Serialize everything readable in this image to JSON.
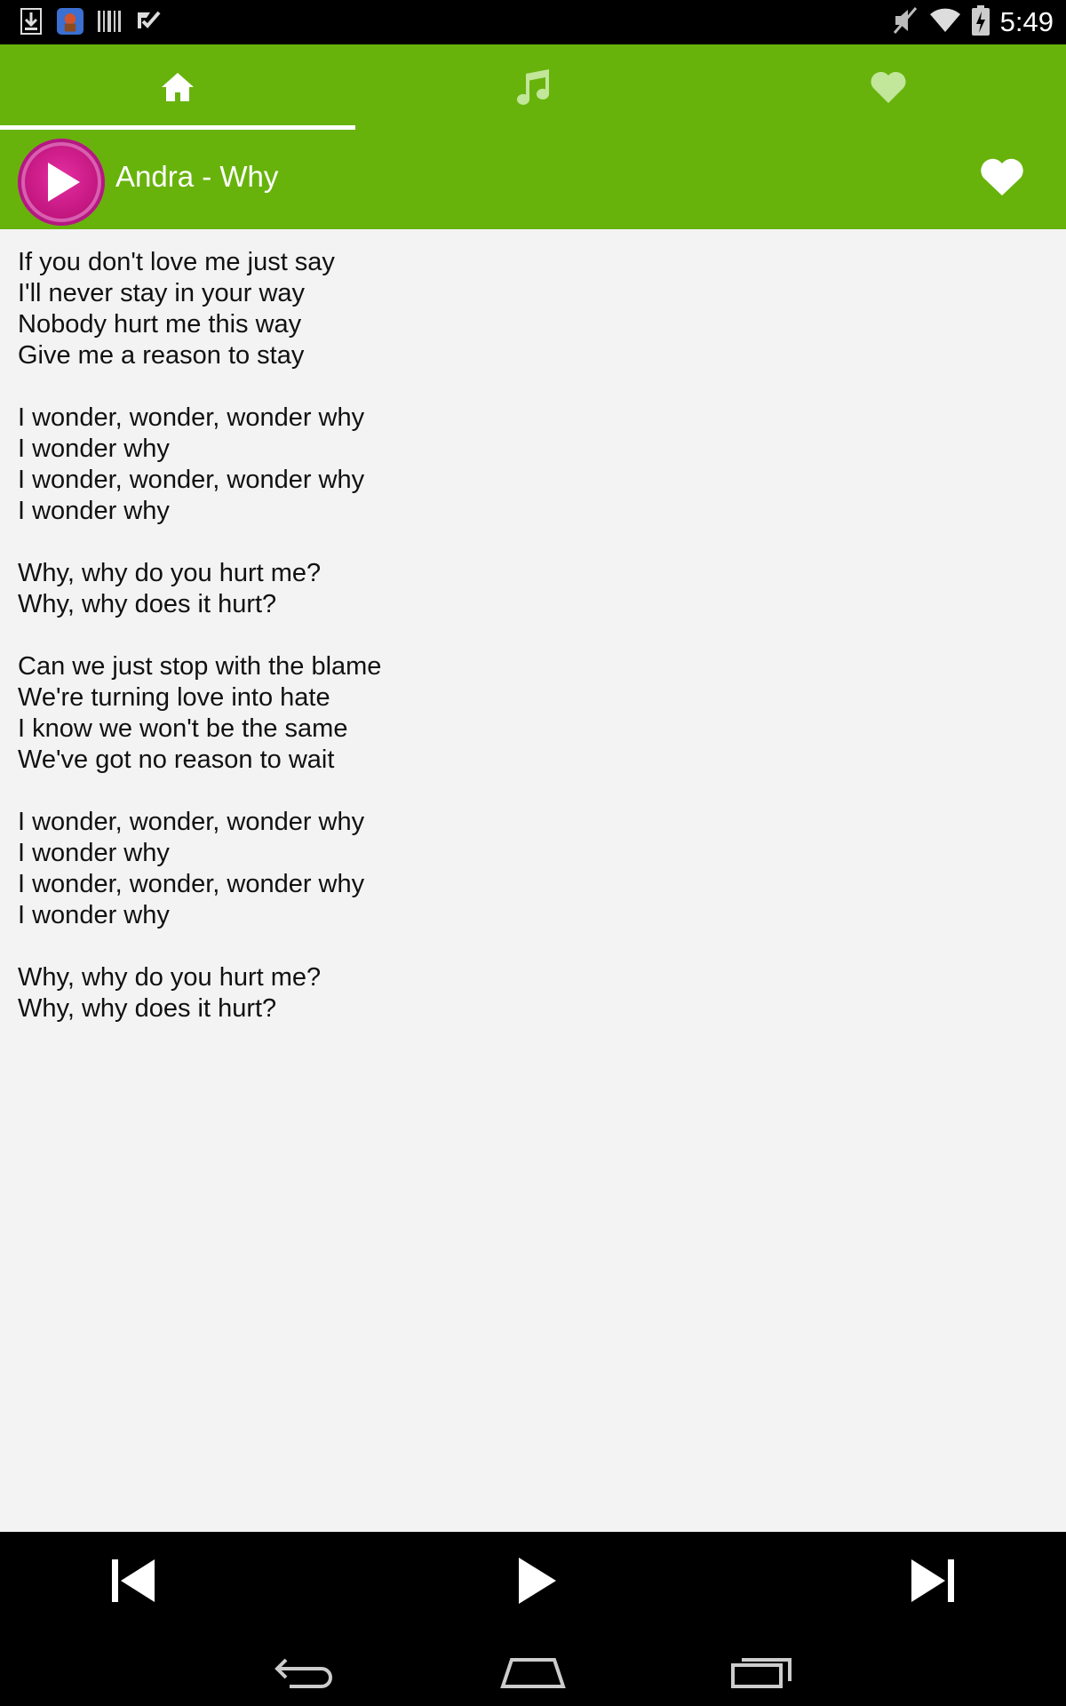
{
  "status_bar": {
    "time": "5:49",
    "left_icons": [
      "download-icon",
      "app-notification-icon",
      "barcode-icon",
      "check-icon"
    ],
    "right_icons": [
      "mute-icon",
      "wifi-icon",
      "battery-charging-icon"
    ]
  },
  "tabs": [
    {
      "name": "home",
      "icon": "home-icon",
      "selected": true
    },
    {
      "name": "music",
      "icon": "music-note-icon",
      "selected": false
    },
    {
      "name": "favorites",
      "icon": "heart-icon",
      "selected": false
    }
  ],
  "now_playing": {
    "title": "Andra - Why"
  },
  "lyrics": "If you don't love me just say\nI'll never stay in your way\nNobody hurt me this way\nGive me a reason to stay\n\nI wonder, wonder, wonder why\nI wonder why\nI wonder, wonder, wonder why\nI wonder why\n\nWhy, why do you hurt me?\nWhy, why does it hurt?\n\nCan we just stop with the blame\nWe're turning love into hate\nI know we won't be the same\nWe've got no reason to wait\n\nI wonder, wonder, wonder why\nI wonder why\nI wonder, wonder, wonder why\nI wonder why\n\nWhy, why do you hurt me?\nWhy, why does it hurt?",
  "colors": {
    "accent": "#67b30c",
    "play_button": "#c2167f",
    "background": "#f4f3f4"
  },
  "controls": [
    "previous-icon",
    "play-icon",
    "next-icon"
  ],
  "nav": [
    "back-icon",
    "home-icon",
    "recents-icon"
  ]
}
